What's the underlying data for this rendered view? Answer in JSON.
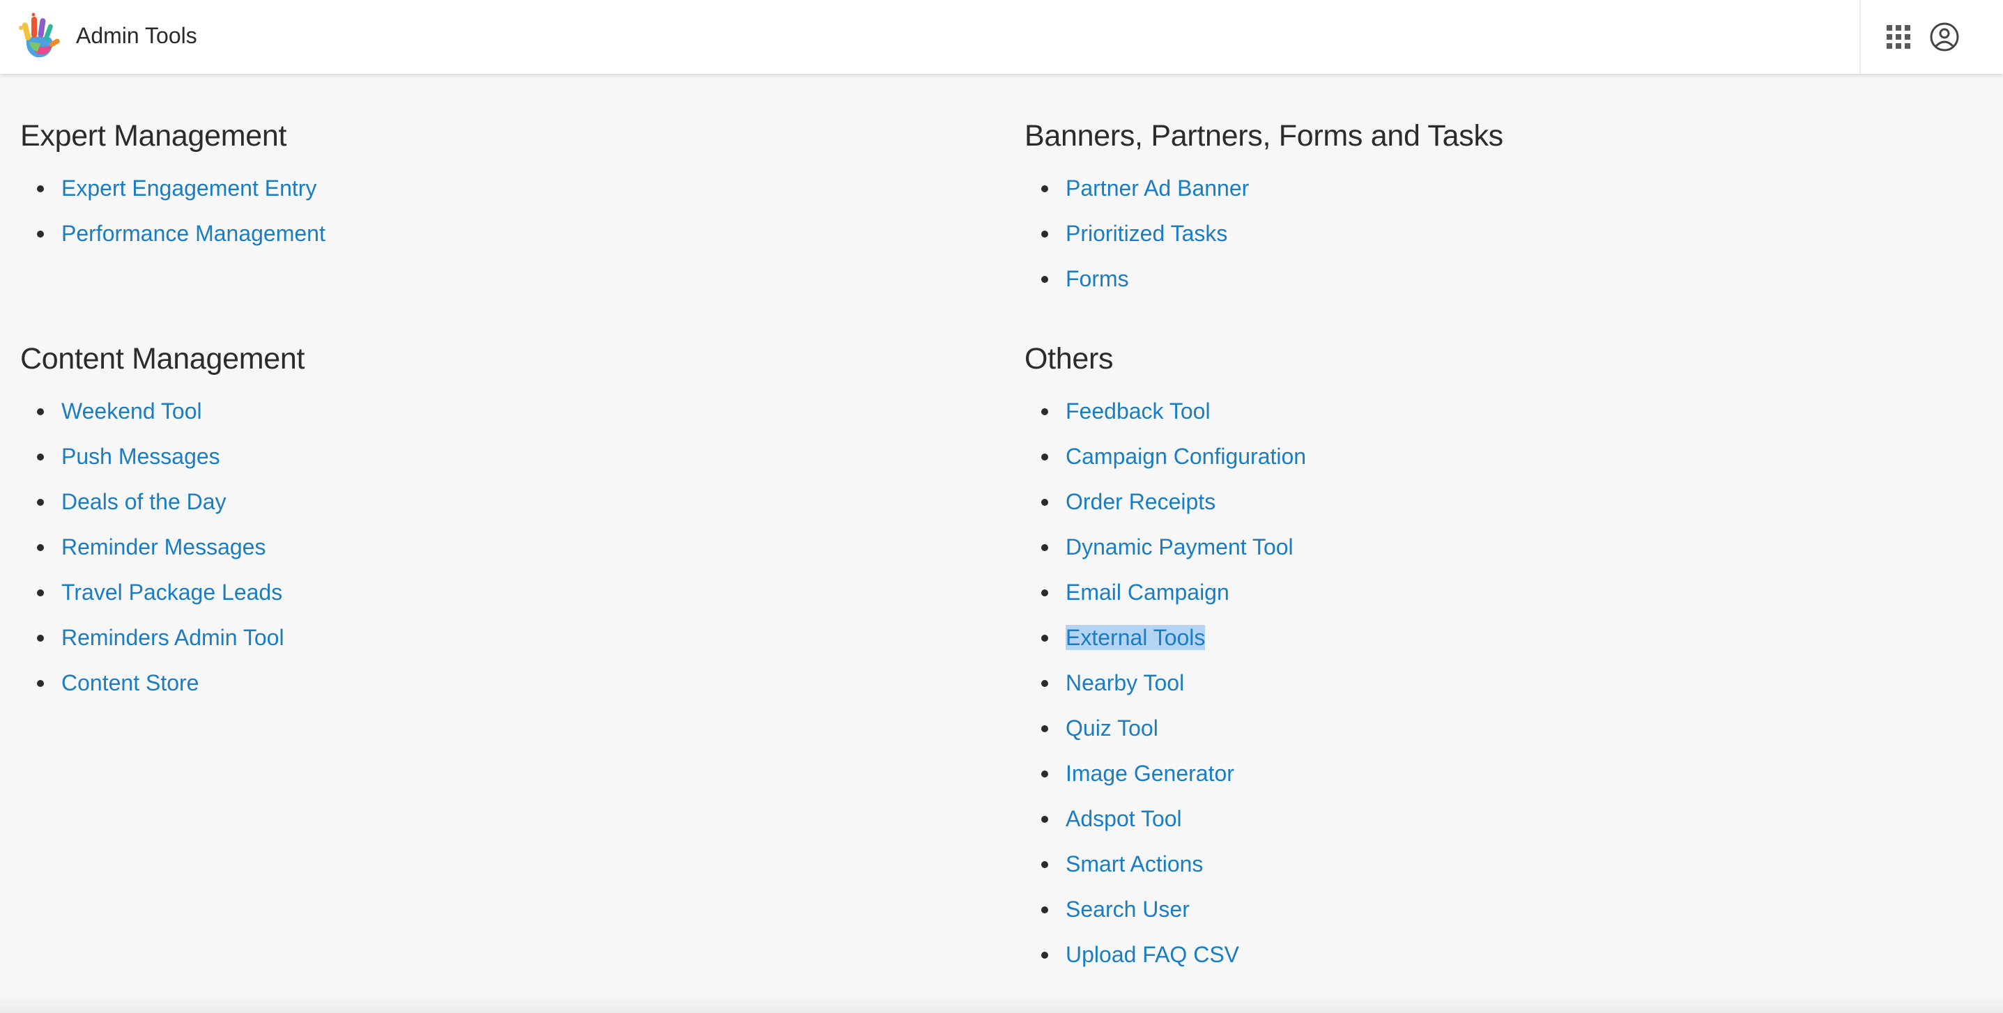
{
  "header": {
    "title": "Admin Tools",
    "logo_icon": "colorful-hand-logo-icon",
    "apps_icon": "apps-grid-icon",
    "account_icon": "account-circle-icon"
  },
  "colors": {
    "link": "#1a7dc4",
    "selection": "#b3d4f3",
    "heading": "#2b2b2b",
    "background": "#f7f7f7"
  },
  "sections": {
    "expert": {
      "title": "Expert Management",
      "items": [
        "Expert Engagement Entry",
        "Performance Management"
      ]
    },
    "banners": {
      "title": "Banners, Partners, Forms and Tasks",
      "items": [
        "Partner Ad Banner",
        "Prioritized Tasks",
        "Forms"
      ]
    },
    "content": {
      "title": "Content Management",
      "items": [
        "Weekend Tool",
        "Push Messages",
        "Deals of the Day",
        "Reminder Messages",
        "Travel Package Leads",
        "Reminders Admin Tool",
        "Content Store"
      ]
    },
    "others": {
      "title": "Others",
      "selected_item": "External Tools",
      "items": [
        "Feedback Tool",
        "Campaign Configuration",
        "Order Receipts",
        "Dynamic Payment Tool",
        "Email Campaign",
        "External Tools",
        "Nearby Tool",
        "Quiz Tool",
        "Image Generator",
        "Adspot Tool",
        "Smart Actions",
        "Search User",
        "Upload FAQ CSV"
      ]
    }
  }
}
